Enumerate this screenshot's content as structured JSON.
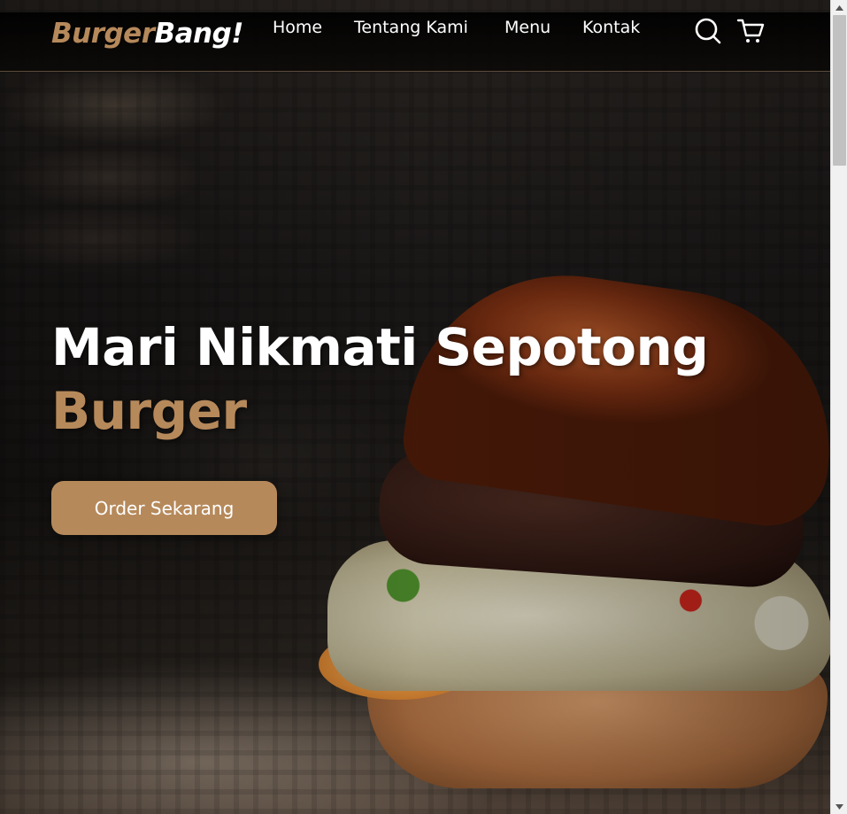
{
  "brand": {
    "part1": "Burger",
    "part2": "Bang!"
  },
  "nav": {
    "items": [
      {
        "label": "Home"
      },
      {
        "label": "Tentang Kami"
      },
      {
        "label": "Menu"
      },
      {
        "label": "Kontak"
      }
    ],
    "icons": [
      "search-icon",
      "cart-icon"
    ]
  },
  "hero": {
    "title_line1": "Mari Nikmati Sepotong",
    "title_line2": "Burger",
    "cta_label": "Order Sekarang"
  },
  "colors": {
    "accent": "#b6895b",
    "text": "#ffffff",
    "navbar_bg": "#000000"
  }
}
